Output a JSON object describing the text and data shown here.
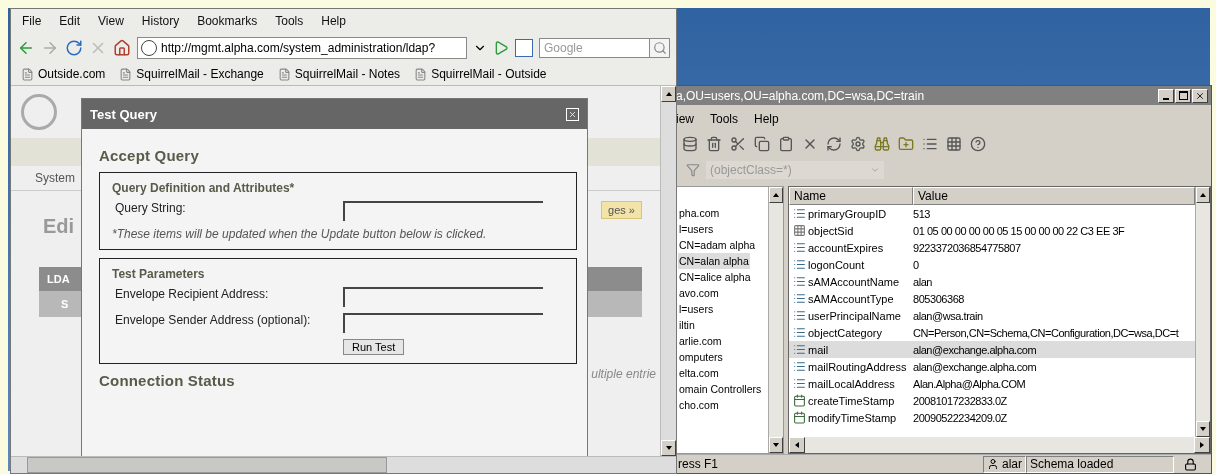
{
  "browser": {
    "menu": [
      "File",
      "Edit",
      "View",
      "History",
      "Bookmarks",
      "Tools",
      "Help"
    ],
    "address": "http://mgmt.alpha.com/system_administration/ldap?",
    "search_placeholder": "Google",
    "bookmarks": [
      "Outside.com",
      "SquirrelMail - Exchange",
      "SquirrelMail - Notes",
      "SquirrelMail - Outside"
    ],
    "page": {
      "nav_label": "System",
      "title": "Edi",
      "side_button": "ges »",
      "bar_label": "LDA",
      "sub_label": "S",
      "note": "ultiple entrie"
    },
    "dialog": {
      "title": "Test Query",
      "heading": "Accept Query",
      "sections": [
        {
          "title": "Query Definition and Attributes*",
          "fields": [
            {
              "label": "Query String:"
            }
          ],
          "note": "*These items will be updated when the Update button below is clicked."
        },
        {
          "title": "Test Parameters",
          "fields": [
            {
              "label": "Envelope Recipient Address:"
            },
            {
              "label": "Envelope Sender Address (optional):"
            }
          ],
          "button": "Run Test"
        }
      ],
      "footer_heading": "Connection Status"
    }
  },
  "ldap_window": {
    "title": "a,OU=users,OU=alpha.com,DC=wsa,DC=train",
    "menu": [
      "iew",
      "Tools",
      "Help"
    ],
    "filter": "(objectClass=*)",
    "tree": [
      {
        "label": "pha.com",
        "selected": false
      },
      {
        "label": "l=users",
        "selected": false
      },
      {
        "label": "CN=adam alpha",
        "selected": false
      },
      {
        "label": "CN=alan alpha",
        "selected": true
      },
      {
        "label": "CN=alice alpha",
        "selected": false
      },
      {
        "label": "avo.com",
        "selected": false
      },
      {
        "label": "l=users",
        "selected": false
      },
      {
        "label": "iltin",
        "selected": false
      },
      {
        "label": "arlie.com",
        "selected": false
      },
      {
        "label": "omputers",
        "selected": false
      },
      {
        "label": "elta.com",
        "selected": false
      },
      {
        "label": "omain Controllers",
        "selected": false
      },
      {
        "label": "cho.com",
        "selected": false
      }
    ],
    "columns": [
      "Name",
      "Value"
    ],
    "rows": [
      {
        "name": "primaryGroupID",
        "value": "513",
        "kind": "list",
        "selected": false
      },
      {
        "name": "objectSid",
        "value": "01 05 00 00 00 00 05 15 00 00 00 22 C3 EE 3F",
        "kind": "binary",
        "selected": false
      },
      {
        "name": "accountExpires",
        "value": "9223372036854775807",
        "kind": "list",
        "selected": false
      },
      {
        "name": "logonCount",
        "value": "0",
        "kind": "list",
        "selected": false
      },
      {
        "name": "sAMAccountName",
        "value": "alan",
        "kind": "list",
        "selected": false
      },
      {
        "name": "sAMAccountType",
        "value": "805306368",
        "kind": "list",
        "selected": false
      },
      {
        "name": "userPrincipalName",
        "value": "alan@wsa.train",
        "kind": "list",
        "selected": false
      },
      {
        "name": "objectCategory",
        "value": "CN=Person,CN=Schema,CN=Configuration,DC=wsa,DC=t",
        "kind": "list",
        "selected": false
      },
      {
        "name": "mail",
        "value": "alan@exchange.alpha.com",
        "kind": "list",
        "selected": true
      },
      {
        "name": "mailRoutingAddress",
        "value": "alan@exchange.alpha.com",
        "kind": "list",
        "selected": false
      },
      {
        "name": "mailLocalAddress",
        "value": "Alan.Alpha@Alpha.COM",
        "kind": "list",
        "selected": false
      },
      {
        "name": "createTimeStamp",
        "value": "20081017232833.0Z",
        "kind": "timestamp",
        "selected": false
      },
      {
        "name": "modifyTimeStamp",
        "value": "20090522234209.0Z",
        "kind": "timestamp",
        "selected": false
      }
    ],
    "status": {
      "hint": "ress F1",
      "user": "alar",
      "message": "Schema loaded"
    }
  }
}
